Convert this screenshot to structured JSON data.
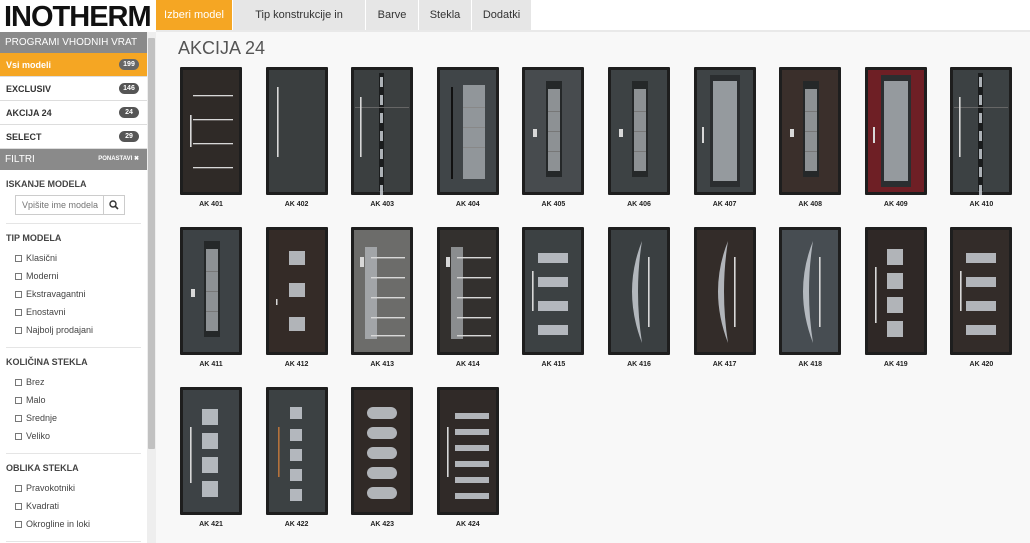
{
  "brand": {
    "logo": "INOTHERM"
  },
  "nav": {
    "tabs": [
      {
        "label": "Izberi model",
        "active": true
      },
      {
        "label": "Tip konstrukcije in dimenzije",
        "active": false
      },
      {
        "label": "Barve",
        "active": false
      },
      {
        "label": "Stekla",
        "active": false
      },
      {
        "label": "Dodatki",
        "active": false
      }
    ]
  },
  "sidebar": {
    "programs_title": "PROGRAMI VHODNIH VRAT",
    "programs": [
      {
        "label": "Vsi modeli",
        "count": "199",
        "active": true
      },
      {
        "label": "EXCLUSIV",
        "count": "146",
        "active": false
      },
      {
        "label": "AKCIJA 24",
        "count": "24",
        "active": false
      },
      {
        "label": "SELECT",
        "count": "29",
        "active": false
      }
    ],
    "filters_title": "FILTRI",
    "reset_label": "PONASTAVI ✖",
    "search_title": "ISKANJE MODELA",
    "search_placeholder": "Vpišite ime modela",
    "groups": [
      {
        "title": "TIP MODELA",
        "options": [
          "Klasični",
          "Moderni",
          "Ekstravagantni",
          "Enostavni",
          "Najbolj prodajani"
        ]
      },
      {
        "title": "KOLIČINA STEKLA",
        "options": [
          "Brez",
          "Malo",
          "Srednje",
          "Veliko"
        ]
      },
      {
        "title": "OBLIKA STEKLA",
        "options": [
          "Pravokotniki",
          "Kvadrati",
          "Okrogline in loki"
        ]
      }
    ]
  },
  "main": {
    "title": "AKCIJA 24",
    "doors": [
      {
        "label": "AK 401",
        "color": "#2f2a27",
        "style": "bars"
      },
      {
        "label": "AK 402",
        "color": "#3a3e3f",
        "style": "plain"
      },
      {
        "label": "AK 403",
        "color": "#3b3f40",
        "style": "strip"
      },
      {
        "label": "AK 404",
        "color": "#404548",
        "style": "longglass"
      },
      {
        "label": "AK 405",
        "color": "#474b4e",
        "style": "glass"
      },
      {
        "label": "AK 406",
        "color": "#3d4244",
        "style": "glass"
      },
      {
        "label": "AK 407",
        "color": "#3e4345",
        "style": "wideglass"
      },
      {
        "label": "AK 408",
        "color": "#3a2f2b",
        "style": "glass"
      },
      {
        "label": "AK 409",
        "color": "#6e1f25",
        "style": "wideglass"
      },
      {
        "label": "AK 410",
        "color": "#3c4143",
        "style": "strip"
      },
      {
        "label": "AK 411",
        "color": "#3d4245",
        "style": "glass"
      },
      {
        "label": "AK 412",
        "color": "#342b27",
        "style": "squares3"
      },
      {
        "label": "AK 413",
        "color": "#6c6c6a",
        "style": "barsglass"
      },
      {
        "label": "AK 414",
        "color": "#33302e",
        "style": "barsglass"
      },
      {
        "label": "AK 415",
        "color": "#3c4143",
        "style": "hbars"
      },
      {
        "label": "AK 416",
        "color": "#3a3f41",
        "style": "arc"
      },
      {
        "label": "AK 417",
        "color": "#332c29",
        "style": "arc"
      },
      {
        "label": "AK 418",
        "color": "#474d52",
        "style": "arc"
      },
      {
        "label": "AK 419",
        "color": "#2f2826",
        "style": "squares4"
      },
      {
        "label": "AK 420",
        "color": "#332c29",
        "style": "hbars"
      },
      {
        "label": "AK 421",
        "color": "#3d4245",
        "style": "squares4"
      },
      {
        "label": "AK 422",
        "color": "#3c4143",
        "style": "squares5"
      },
      {
        "label": "AK 423",
        "color": "#312a27",
        "style": "ovals"
      },
      {
        "label": "AK 424",
        "color": "#302a28",
        "style": "hstrips"
      }
    ]
  }
}
